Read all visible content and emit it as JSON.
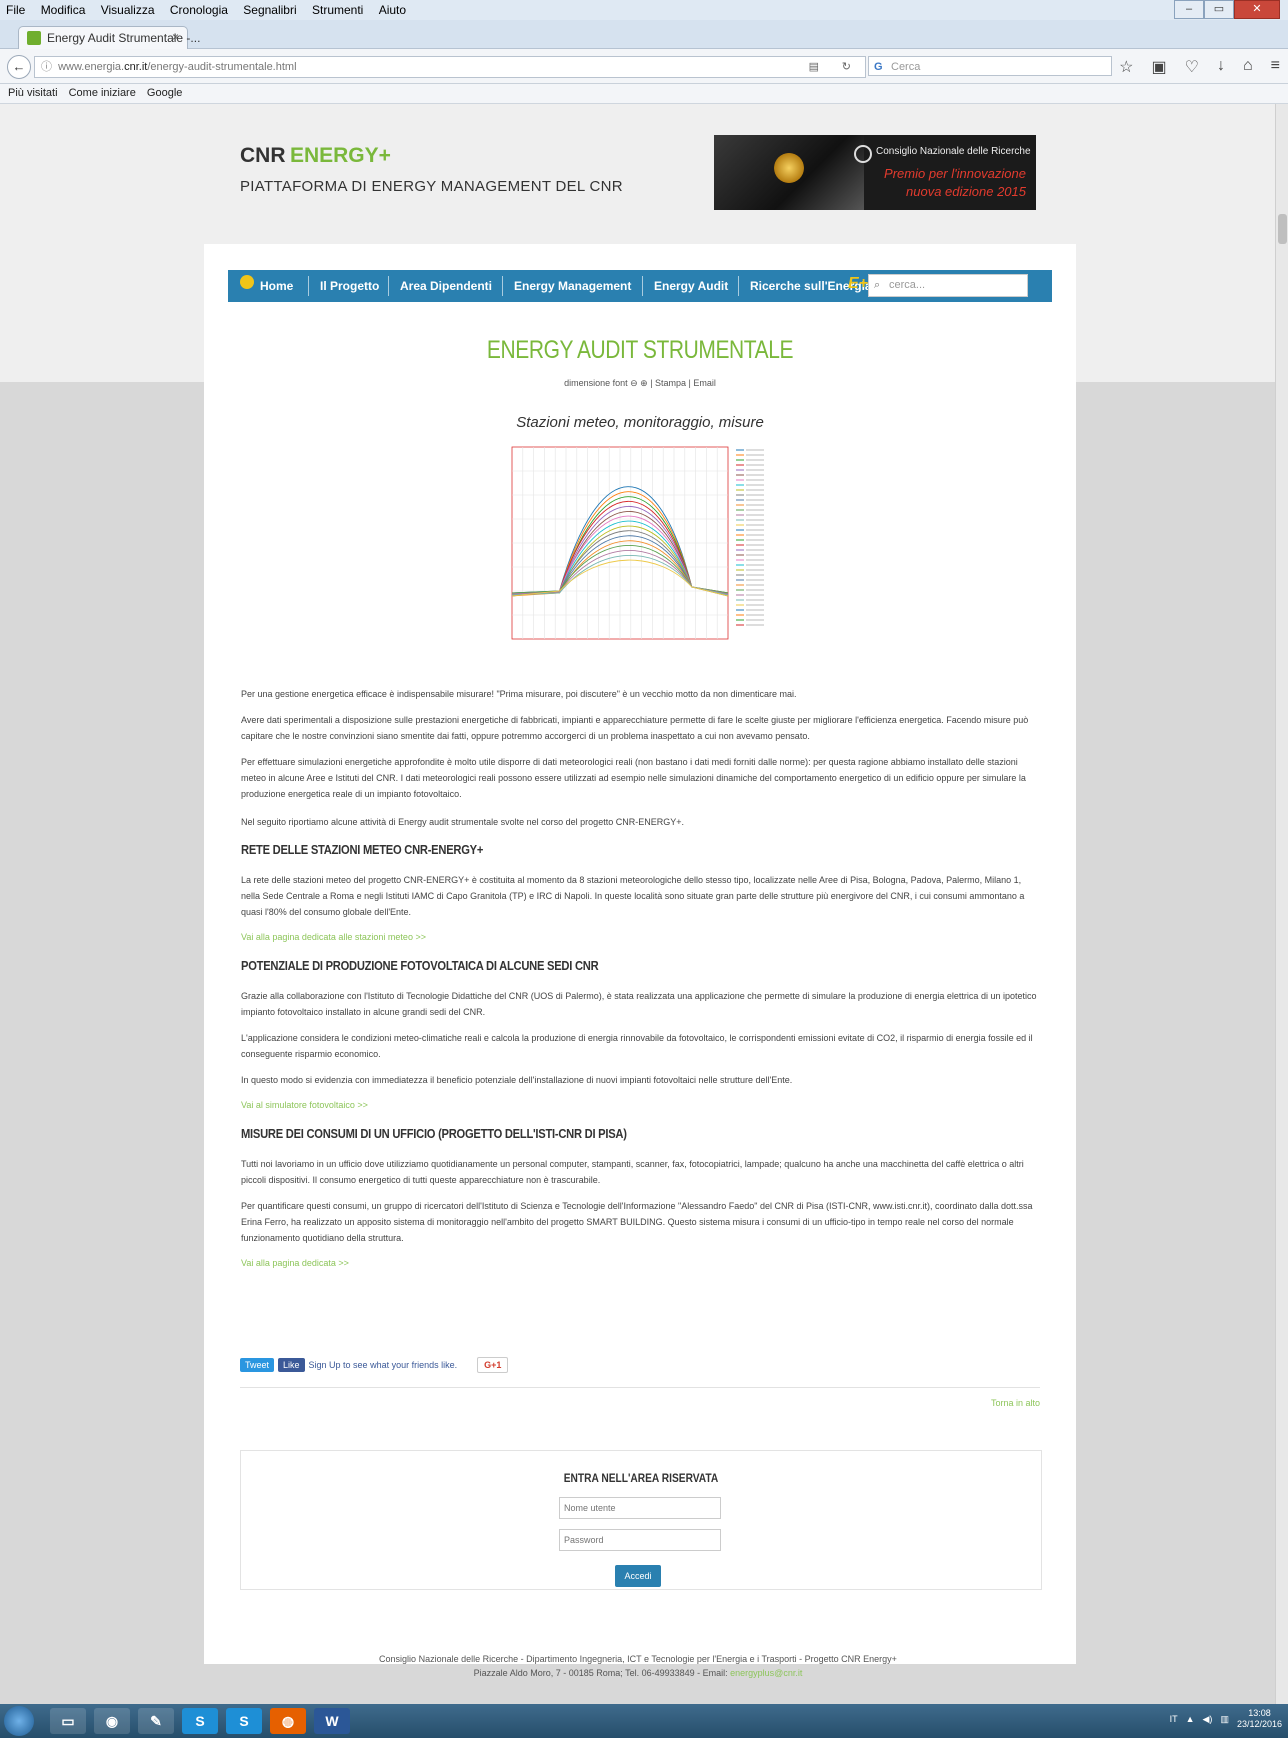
{
  "browser": {
    "menu": [
      "File",
      "Modifica",
      "Visualizza",
      "Cronologia",
      "Segnalibri",
      "Strumenti",
      "Aiuto"
    ],
    "tab_title": "Energy Audit Strumentale -...",
    "tab_close": "×",
    "new_tab": "+",
    "url_prefix": "www.energia.",
    "url_host": "cnr.it",
    "url_path": "/energy-audit-strumentale.html",
    "search_placeholder": "Cerca",
    "bookmarks": [
      "Più visitati",
      "Come iniziare",
      "Google"
    ]
  },
  "site": {
    "brand_cnr": "CNR",
    "brand_energy": "ENERGY+",
    "subtitle": "PIATTAFORMA DI ENERGY MANAGEMENT DEL CNR",
    "banner_line1": "Consiglio Nazionale delle Ricerche",
    "banner_line2": "Premio per l'innovazione",
    "banner_line3": "nuova edizione 2015"
  },
  "nav": {
    "items": [
      "Home",
      "Il Progetto",
      "Area Dipendenti",
      "Energy Management",
      "Energy Audit",
      "Ricerche sull'Energia"
    ],
    "search_placeholder": "cerca..."
  },
  "article": {
    "title": "ENERGY AUDIT STRUMENTALE",
    "tools": "dimensione font ⊖ ⊕  |  Stampa  |  Email",
    "chart_title": "Stazioni meteo, monitoraggio, misure",
    "p1": "Per una gestione energetica efficace è indispensabile misurare! \"Prima misurare, poi discutere\" è un vecchio motto da non dimenticare mai.",
    "p2": "Avere dati sperimentali a disposizione sulle prestazioni energetiche di fabbricati, impianti e apparecchiature permette di fare le scelte giuste per migliorare l'efficienza energetica. Facendo misure può capitare che le nostre convinzioni siano smentite dai fatti, oppure potremmo accorgerci di un problema inaspettato a cui non avevamo pensato.",
    "p3": "Per effettuare simulazioni energetiche approfondite è molto utile disporre di dati meteorologici reali (non bastano i dati medi forniti dalle norme): per questa ragione abbiamo installato delle stazioni meteo in alcune Aree e Istituti del CNR. I dati meteorologici reali possono essere utilizzati ad esempio nelle simulazioni dinamiche del comportamento energetico di un edificio oppure per simulare la produzione energetica reale di un impianto fotovoltaico.",
    "p4": "Nel seguito riportiamo alcune attività di Energy audit strumentale svolte nel corso del progetto CNR-ENERGY+.",
    "h_rete": "RETE DELLE STAZIONI METEO CNR-ENERGY+",
    "p_rete": "La rete delle stazioni meteo del progetto CNR-ENERGY+ è costituita al momento da 8 stazioni meteorologiche dello stesso tipo, localizzate nelle Aree di Pisa, Bologna, Padova, Palermo, Milano 1, nella Sede Centrale a Roma e negli Istituti IAMC di Capo Granitola (TP) e IRC di Napoli. In queste località sono situate gran parte delle strutture più energivore del CNR, i cui consumi ammontano a quasi l'80% del consumo globale dell'Ente.",
    "link_rete": "Vai alla pagina dedicata alle stazioni meteo >>",
    "h_fv": "POTENZIALE DI PRODUZIONE FOTOVOLTAICA DI ALCUNE SEDI CNR",
    "p_fv1": "Grazie alla collaborazione con l'Istituto di Tecnologie Didattiche del CNR (UOS di Palermo), è stata realizzata una applicazione che permette di simulare la produzione di energia elettrica di un ipotetico impianto fotovoltaico installato in alcune grandi sedi del CNR.",
    "p_fv2": "L'applicazione considera le condizioni meteo-climatiche reali e calcola la produzione di energia rinnovabile da fotovoltaico, le corrispondenti emissioni evitate di CO2, il risparmio di energia fossile ed il conseguente risparmio economico.",
    "p_fv3": "In questo modo si evidenzia con immediatezza il beneficio potenziale dell'installazione di nuovi impianti fotovoltaici nelle strutture dell'Ente.",
    "link_fv": "Vai al simulatore fotovoltaico >>",
    "h_uff": "MISURE DEI CONSUMI DI UN UFFICIO (PROGETTO DELL'ISTI-CNR DI PISA)",
    "p_uff1": "Tutti noi lavoriamo in un ufficio dove utilizziamo quotidianamente un personal computer, stampanti, scanner, fax, fotocopiatrici, lampade; qualcuno ha anche una macchinetta del caffè elettrica o altri piccoli dispositivi. Il consumo energetico di tutti queste apparecchiature non è trascurabile.",
    "p_uff2": "Per quantificare questi consumi, un gruppo di ricercatori dell'Istituto di Scienza e Tecnologie dell'Informazione \"Alessandro Faedo\" del CNR di Pisa (ISTI-CNR, www.isti.cnr.it), coordinato dalla dott.ssa Erina Ferro, ha realizzato un apposito sistema di monitoraggio nell'ambito del progetto SMART BUILDING. Questo sistema misura i consumi di un ufficio-tipo in tempo reale nel corso del normale funzionamento quotidiano della struttura.",
    "link_uff": "Vai alla pagina dedicata >>"
  },
  "social": {
    "tweet": "Tweet",
    "like": "Like",
    "signup": "Sign Up to see what your friends like.",
    "gplus": "G+1"
  },
  "back_to_top": "Torna in alto",
  "login": {
    "title": "ENTRA NELL'AREA RISERVATA",
    "username_placeholder": "Nome utente",
    "password_placeholder": "Password",
    "submit": "Accedi"
  },
  "footer": {
    "line1": "Consiglio Nazionale delle Ricerche - Dipartimento Ingegneria, ICT e Tecnologie per l'Energia e i Trasporti - Progetto CNR Energy+",
    "line2": "Piazzale Aldo Moro, 7 - 00185 Roma; Tel. 06-49933849 - Email: ",
    "email": "energyplus@cnr.it"
  },
  "taskbar": {
    "lang": "IT",
    "time": "13:08",
    "date": "23/12/2016"
  },
  "colors": {
    "accent_green": "#7ab83b",
    "nav_blue": "#2a80b0"
  }
}
